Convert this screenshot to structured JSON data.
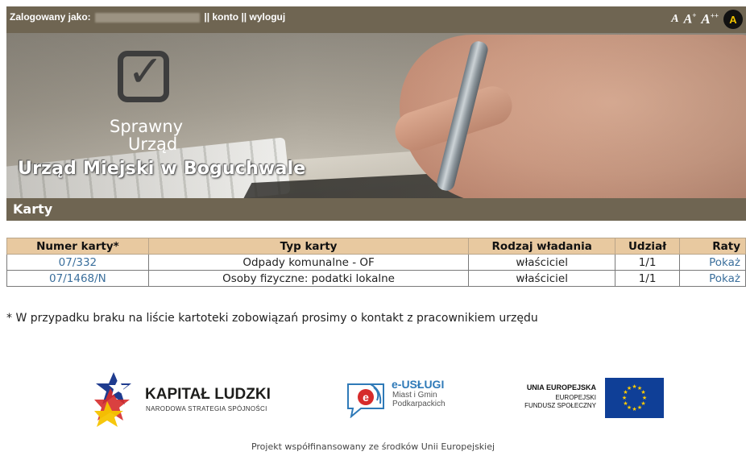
{
  "topbar": {
    "login_label": "Zalogowany jako:",
    "separator1": "||",
    "account_link": "konto",
    "separator2": "||",
    "logout_link": "wyloguj",
    "font_small": "A",
    "font_medium": "A",
    "font_medium_sup": "+",
    "font_large": "A",
    "font_large_sup": "++",
    "contrast": "A"
  },
  "banner": {
    "brand_line1": "Sprawny",
    "brand_line2": "Urząd",
    "office_name": "Urząd Miejski w Boguchwale",
    "logo_icon": "checkbox-icon"
  },
  "section": {
    "title": "Karty"
  },
  "table": {
    "headers": [
      "Numer karty*",
      "Typ karty",
      "Rodzaj władania",
      "Udział",
      "Raty"
    ],
    "rows": [
      {
        "numer": "07/332",
        "typ": "Odpady komunalne - OF",
        "rodzaj": "właściciel",
        "udzial": "1/1",
        "raty": "Pokaż"
      },
      {
        "numer": "07/1468/N",
        "typ": "Osoby fizyczne: podatki lokalne",
        "rodzaj": "właściciel",
        "udzial": "1/1",
        "raty": "Pokaż"
      }
    ]
  },
  "note": "* W przypadku braku na liście kartoteki zobowiązań prosimy o kontakt z pracownikiem urzędu",
  "logos": {
    "kl_title": "KAPITAŁ LUDZKI",
    "kl_sub": "NARODOWA STRATEGIA SPÓJNOŚCI",
    "eu_title": "e-USŁUGI",
    "eu_sub1": "Miast i Gmin",
    "eu_sub2": "Podkarpackich",
    "ue_title": "UNIA EUROPEJSKA",
    "ue_line1": "EUROPEJSKI",
    "ue_line2": "FUNDUSZ SPOŁECZNY"
  },
  "footer": "Projekt współfinansowany ze środków Unii Europejskiej",
  "colors": {
    "bar": "#6f6552",
    "header_bg": "#e8c9a0",
    "link": "#3b6f9c"
  }
}
